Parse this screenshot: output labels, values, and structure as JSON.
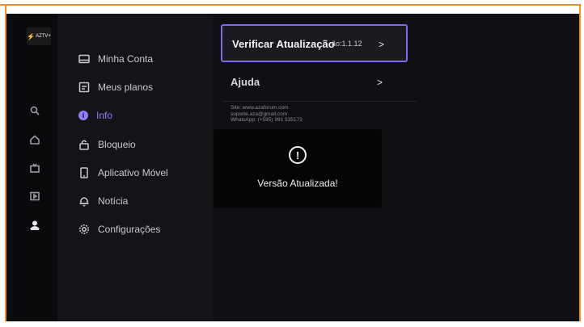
{
  "app": {
    "logo_text": "AZTV+"
  },
  "rail": {
    "icons": [
      "search-icon",
      "home-icon",
      "tv-icon",
      "play-icon",
      "profile-icon"
    ]
  },
  "menu": {
    "items": [
      {
        "label": "Minha Conta",
        "icon": "account-icon"
      },
      {
        "label": "Meus planos",
        "icon": "plans-icon"
      },
      {
        "label": "Info",
        "icon": "info-icon",
        "active": true
      },
      {
        "label": "Bloqueio",
        "icon": "lock-icon"
      },
      {
        "label": "Aplicativo Móvel",
        "icon": "mobile-icon"
      },
      {
        "label": "Notícia",
        "icon": "bell-icon"
      },
      {
        "label": "Configurações",
        "icon": "gear-icon"
      }
    ]
  },
  "content": {
    "update_label": "Verificar Atualização",
    "version_text": "ão:1.1.12",
    "chevron": ">",
    "help_label": "Ajuda",
    "site": "Site: www.azaforum.com",
    "email": "suporte.aza@gmail.com",
    "whatsapp": "WhatsApp: (+595) 991 535173"
  },
  "modal": {
    "icon_glyph": "!",
    "message": "Versão Atualizada!"
  },
  "colors": {
    "accent": "#8f7cff",
    "border": "#e8902a"
  }
}
